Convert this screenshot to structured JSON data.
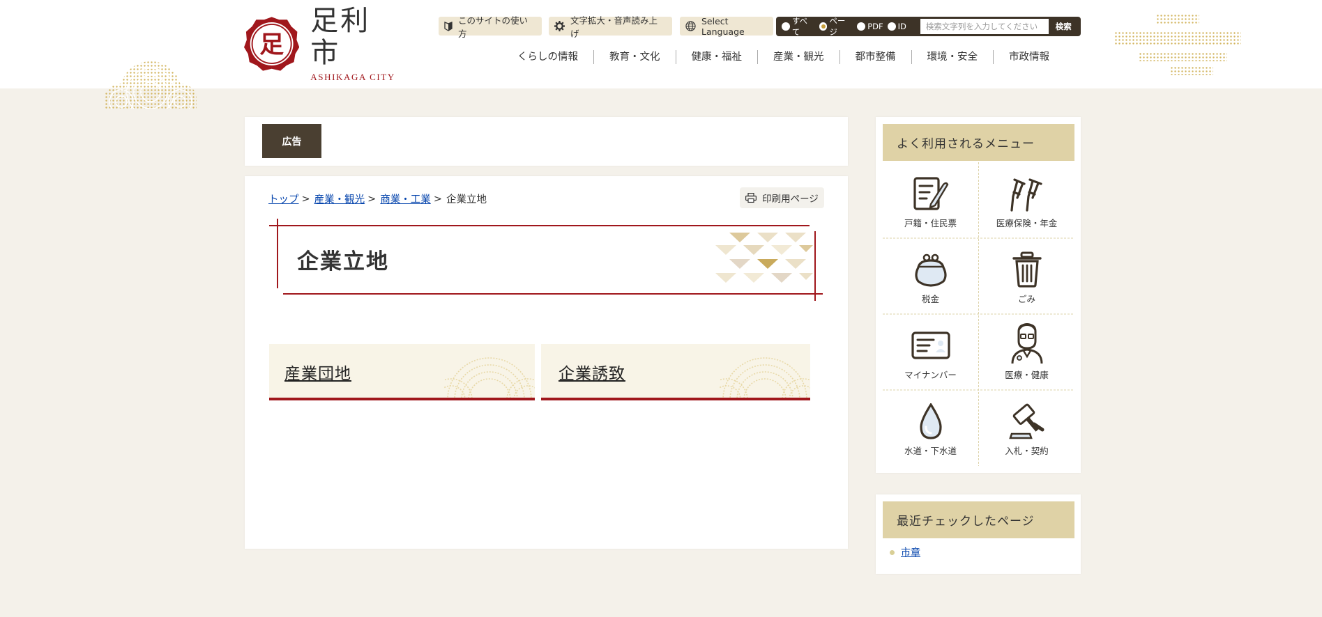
{
  "site": {
    "logo_title": "足利市",
    "logo_sub": "ASHIKAGA CITY",
    "logo_mark_char": "足"
  },
  "utility": {
    "how_to_use": "このサイトの使い方",
    "text_size_voice": "文字拡大・音声読み上げ",
    "select_language": "Select Language"
  },
  "search": {
    "options": [
      "すべて",
      "ページ",
      "PDF",
      "ID"
    ],
    "selected": "ページ",
    "placeholder": "検索文字列を入力してください",
    "button": "検索"
  },
  "global_nav": [
    "くらしの情報",
    "教育・文化",
    "健康・福祉",
    "産業・観光",
    "都市整備",
    "環境・安全",
    "市政情報"
  ],
  "ad_label": "広告",
  "breadcrumb": {
    "links": [
      "トップ",
      "産業・観光",
      "商業・工業"
    ],
    "current": "企業立地",
    "separator": ">"
  },
  "print_button": "印刷用ページ",
  "page_title": "企業立地",
  "cards": [
    "産業団地",
    "企業誘致"
  ],
  "sidebar": {
    "menu_title": "よく利用されるメニュー",
    "menu_items": [
      {
        "label": "戸籍・住民票",
        "icon": "document-pen-icon"
      },
      {
        "label": "医療保険・年金",
        "icon": "crutches-icon"
      },
      {
        "label": "税金",
        "icon": "coin-purse-icon"
      },
      {
        "label": "ごみ",
        "icon": "trash-can-icon"
      },
      {
        "label": "マイナンバー",
        "icon": "id-card-icon"
      },
      {
        "label": "医療・健康",
        "icon": "doctor-icon"
      },
      {
        "label": "水道・下水道",
        "icon": "water-drop-icon"
      },
      {
        "label": "入札・契約",
        "icon": "gavel-icon"
      }
    ],
    "recent_title": "最近チェックしたページ",
    "recent_items": [
      "市章"
    ]
  },
  "colors": {
    "accent_red": "#a0171c",
    "header_brown": "#3d3327",
    "sidebar_head": "#dfd2a6",
    "page_bg": "#f4f1ea",
    "gold": "#c8a03c"
  }
}
